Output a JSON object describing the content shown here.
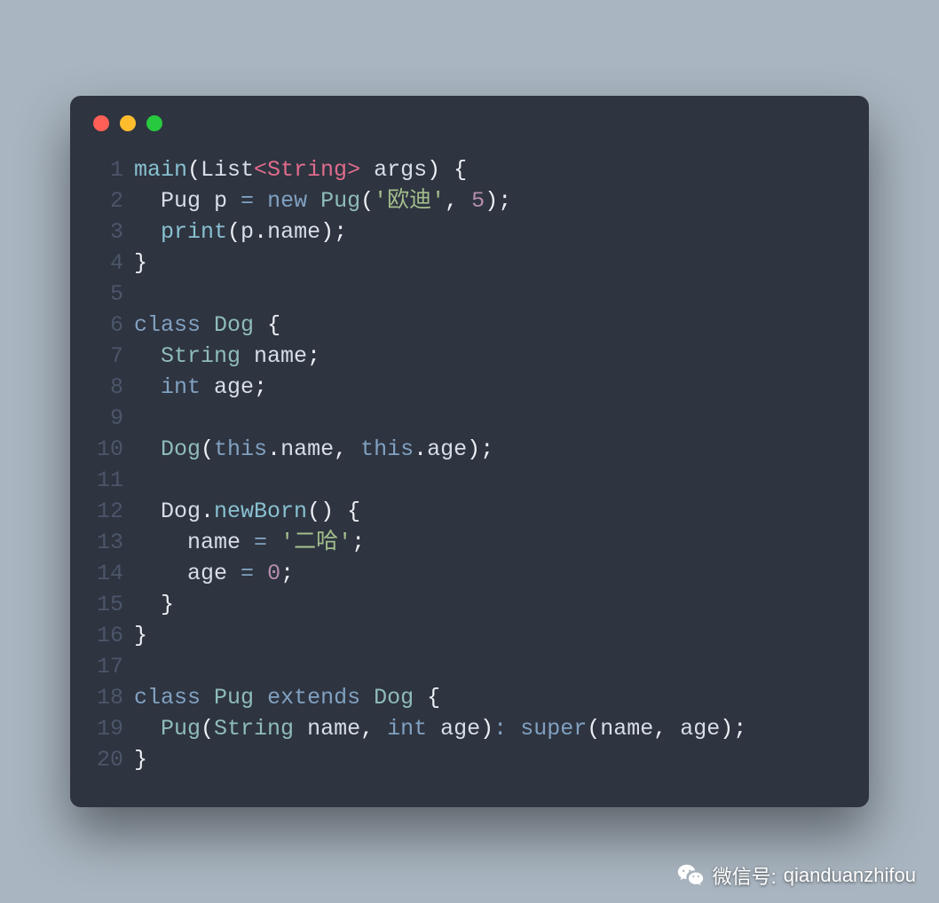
{
  "window": {
    "traffic_lights": [
      "#ff5f56",
      "#ffbd2e",
      "#27c93f"
    ]
  },
  "colors": {
    "bg_page": "#a9b5c0",
    "bg_window": "#2e3440",
    "ln": "#4c566a",
    "plain": "#d8dee9",
    "keyword": "#81a1c1",
    "type": "#8fbcbb",
    "method": "#88c0d0",
    "string": "#a3be8c",
    "number": "#b48ead",
    "punc": "#eceff4",
    "tag": "#e06c8c"
  },
  "code": {
    "language": "dart",
    "lines": [
      {
        "n": 1,
        "tokens": [
          [
            "method",
            "main"
          ],
          [
            "punc",
            "("
          ],
          [
            "plain",
            "List"
          ],
          [
            "tag",
            "<String>"
          ],
          [
            "plain",
            " args"
          ],
          [
            "punc",
            ")"
          ],
          [
            "plain",
            " "
          ],
          [
            "punc",
            "{"
          ]
        ]
      },
      {
        "n": 2,
        "tokens": [
          [
            "plain",
            "  Pug p "
          ],
          [
            "op",
            "="
          ],
          [
            "plain",
            " "
          ],
          [
            "keyword",
            "new"
          ],
          [
            "plain",
            " "
          ],
          [
            "type",
            "Pug"
          ],
          [
            "punc",
            "("
          ],
          [
            "string",
            "'欧迪'"
          ],
          [
            "punc",
            ","
          ],
          [
            "plain",
            " "
          ],
          [
            "number",
            "5"
          ],
          [
            "punc",
            ")"
          ],
          [
            "punc",
            ";"
          ]
        ]
      },
      {
        "n": 3,
        "tokens": [
          [
            "plain",
            "  "
          ],
          [
            "method",
            "print"
          ],
          [
            "punc",
            "("
          ],
          [
            "plain",
            "p"
          ],
          [
            "punc",
            "."
          ],
          [
            "plain",
            "name"
          ],
          [
            "punc",
            ")"
          ],
          [
            "punc",
            ";"
          ]
        ]
      },
      {
        "n": 4,
        "tokens": [
          [
            "punc",
            "}"
          ]
        ]
      },
      {
        "n": 5,
        "tokens": []
      },
      {
        "n": 6,
        "tokens": [
          [
            "keyword",
            "class"
          ],
          [
            "plain",
            " "
          ],
          [
            "type",
            "Dog"
          ],
          [
            "plain",
            " "
          ],
          [
            "punc",
            "{"
          ]
        ]
      },
      {
        "n": 7,
        "tokens": [
          [
            "plain",
            "  "
          ],
          [
            "type",
            "String"
          ],
          [
            "plain",
            " name"
          ],
          [
            "punc",
            ";"
          ]
        ]
      },
      {
        "n": 8,
        "tokens": [
          [
            "plain",
            "  "
          ],
          [
            "keyword",
            "int"
          ],
          [
            "plain",
            " age"
          ],
          [
            "punc",
            ";"
          ]
        ]
      },
      {
        "n": 9,
        "tokens": []
      },
      {
        "n": 10,
        "tokens": [
          [
            "plain",
            "  "
          ],
          [
            "type",
            "Dog"
          ],
          [
            "punc",
            "("
          ],
          [
            "this",
            "this"
          ],
          [
            "punc",
            "."
          ],
          [
            "plain",
            "name"
          ],
          [
            "punc",
            ","
          ],
          [
            "plain",
            " "
          ],
          [
            "this",
            "this"
          ],
          [
            "punc",
            "."
          ],
          [
            "plain",
            "age"
          ],
          [
            "punc",
            ")"
          ],
          [
            "punc",
            ";"
          ]
        ]
      },
      {
        "n": 11,
        "tokens": []
      },
      {
        "n": 12,
        "tokens": [
          [
            "plain",
            "  Dog"
          ],
          [
            "punc",
            "."
          ],
          [
            "method",
            "newBorn"
          ],
          [
            "punc",
            "("
          ],
          [
            "punc",
            ")"
          ],
          [
            "plain",
            " "
          ],
          [
            "punc",
            "{"
          ]
        ]
      },
      {
        "n": 13,
        "tokens": [
          [
            "plain",
            "    name "
          ],
          [
            "op",
            "="
          ],
          [
            "plain",
            " "
          ],
          [
            "string",
            "'二哈'"
          ],
          [
            "punc",
            ";"
          ]
        ]
      },
      {
        "n": 14,
        "tokens": [
          [
            "plain",
            "    age "
          ],
          [
            "op",
            "="
          ],
          [
            "plain",
            " "
          ],
          [
            "number",
            "0"
          ],
          [
            "punc",
            ";"
          ]
        ]
      },
      {
        "n": 15,
        "tokens": [
          [
            "plain",
            "  "
          ],
          [
            "punc",
            "}"
          ]
        ]
      },
      {
        "n": 16,
        "tokens": [
          [
            "punc",
            "}"
          ]
        ]
      },
      {
        "n": 17,
        "tokens": []
      },
      {
        "n": 18,
        "tokens": [
          [
            "keyword",
            "class"
          ],
          [
            "plain",
            " "
          ],
          [
            "type",
            "Pug"
          ],
          [
            "plain",
            " "
          ],
          [
            "keyword",
            "extends"
          ],
          [
            "plain",
            " "
          ],
          [
            "type",
            "Dog"
          ],
          [
            "plain",
            " "
          ],
          [
            "punc",
            "{"
          ]
        ]
      },
      {
        "n": 19,
        "tokens": [
          [
            "plain",
            "  "
          ],
          [
            "type",
            "Pug"
          ],
          [
            "punc",
            "("
          ],
          [
            "type",
            "String"
          ],
          [
            "plain",
            " name"
          ],
          [
            "punc",
            ","
          ],
          [
            "plain",
            " "
          ],
          [
            "keyword",
            "int"
          ],
          [
            "plain",
            " age"
          ],
          [
            "punc",
            ")"
          ],
          [
            "op",
            ":"
          ],
          [
            "plain",
            " "
          ],
          [
            "keyword",
            "super"
          ],
          [
            "punc",
            "("
          ],
          [
            "plain",
            "name"
          ],
          [
            "punc",
            ","
          ],
          [
            "plain",
            " age"
          ],
          [
            "punc",
            ")"
          ],
          [
            "punc",
            ";"
          ]
        ]
      },
      {
        "n": 20,
        "tokens": [
          [
            "punc",
            "}"
          ]
        ]
      }
    ]
  },
  "watermark": {
    "label": "微信号:",
    "account": "qianduanzhifou",
    "icon_name": "wechat-icon"
  }
}
